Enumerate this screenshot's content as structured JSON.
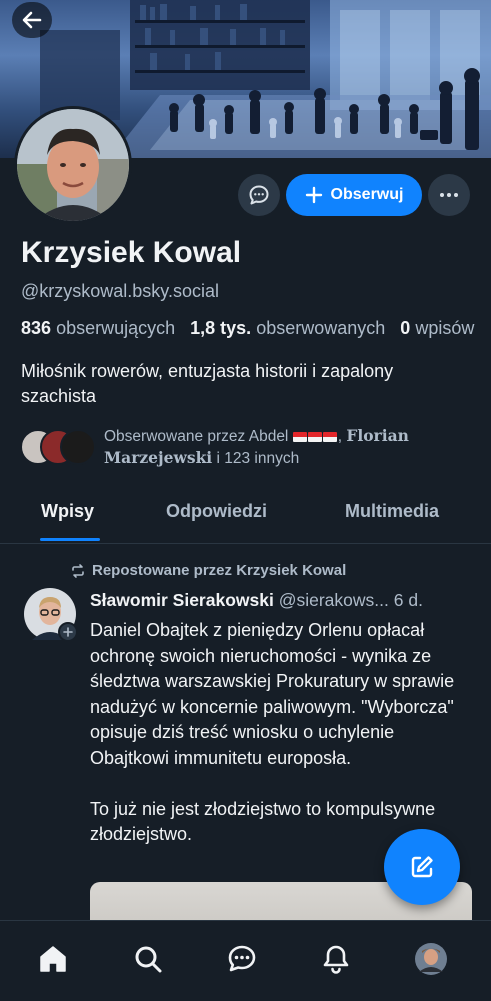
{
  "profile": {
    "display_name": "Krzysiek Kowal",
    "handle": "@krzyskowal.bsky.social",
    "followers_count": "836",
    "followers_label": "obserwujących",
    "following_count": "1,8 tys.",
    "following_label": "obserwowanych",
    "posts_count": "0",
    "posts_label": "wpisów",
    "bio": "Miłośnik rowerów, entuzjasta historii i zapalony szachista"
  },
  "actions": {
    "follow_label": "Obserwuj"
  },
  "followed_by": {
    "prefix": "Obserwowane przez Abdel",
    "name2": "Florian Marzejewski",
    "suffix": "i 123 innych"
  },
  "tabs": [
    "Wpisy",
    "Odpowiedzi",
    "Multimedia"
  ],
  "post": {
    "repost_label": "Repostowane przez Krzysiek Kowal",
    "author_name": "Sławomir Sierakowski",
    "author_handle": "@sierakows...",
    "time_ago": "6 d.",
    "text": "Daniel Obajtek z pieniędzy Orlenu opłacał ochronę swoich nieruchomości - wynika ze śledztwa warszawskiej Prokuratury w sprawie nadużyć w koncernie paliwowym. \"Wyborcza\" opisuje dziś treść wniosku o uchylenie Obajtkowi immunitetu europosła.\n\nTo już nie jest złodziejstwo to kompulsywne złodziejstwo."
  },
  "colors": {
    "background": "#161e27",
    "accent": "#1083fe",
    "text_primary": "#f1f3f5",
    "text_secondary": "#aebbc9"
  },
  "icons": {
    "back": "arrow-left-icon",
    "message": "chat-bubble-icon",
    "follow": "plus-icon",
    "more": "ellipsis-icon",
    "repost": "repost-icon",
    "compose": "edit-icon",
    "nav": [
      "home-icon",
      "search-icon",
      "chat-icon",
      "bell-icon",
      "profile-avatar"
    ]
  }
}
